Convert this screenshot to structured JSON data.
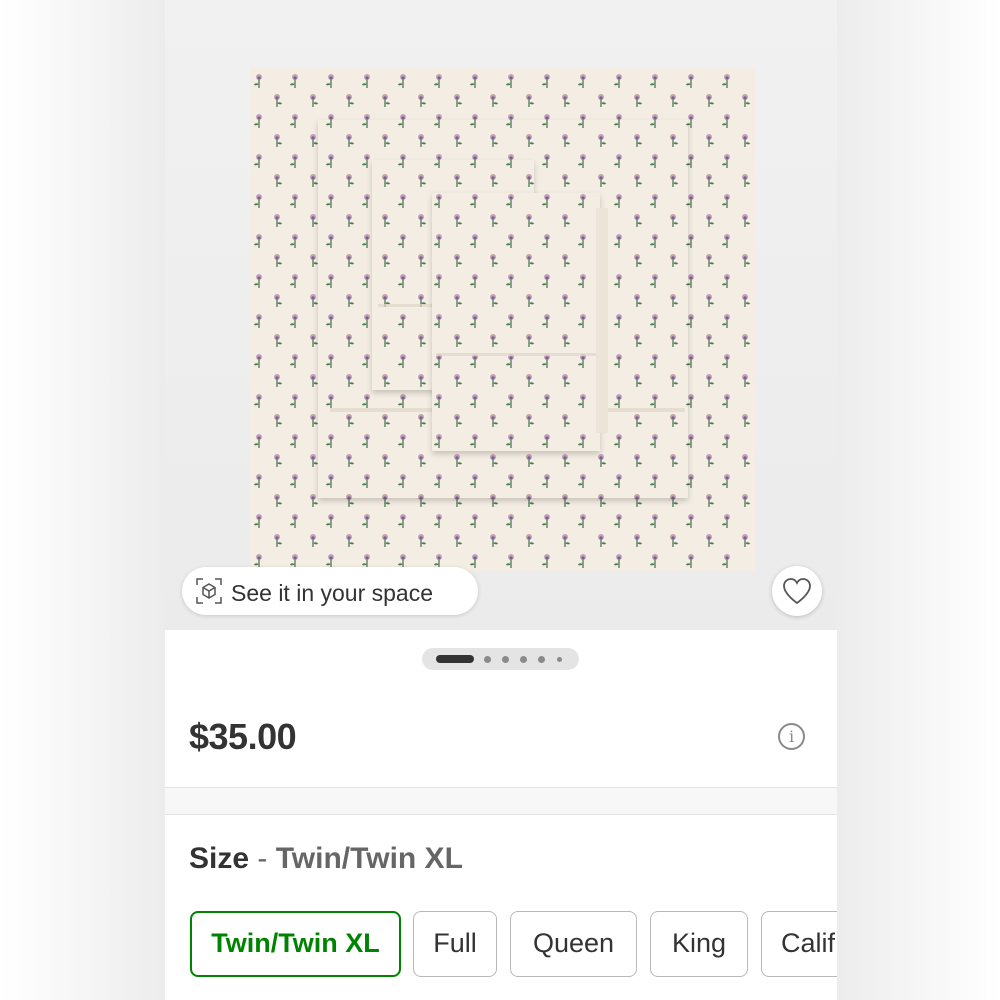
{
  "product": {
    "image_alt": "Floral print sheet set",
    "see_in_space_label": "See it in your space",
    "price": "$35.00",
    "info_glyph": "i"
  },
  "carousel": {
    "total": 6,
    "active": 1
  },
  "size": {
    "label": "Size",
    "separator": " - ",
    "selected": "Twin/Twin XL",
    "options": [
      "Twin/Twin XL",
      "Full",
      "Queen",
      "King",
      "Calif"
    ]
  },
  "colors": {
    "accent_green": "#008300",
    "text_dark": "#333333",
    "text_muted": "#666666",
    "fabric": "#f3ede3",
    "flower_pink": "#c99fb6",
    "flower_purple": "#6e6691",
    "stem_green": "#4f7a56"
  },
  "icons": {
    "ar": "ar-cube-icon",
    "favorite": "heart-outline-icon",
    "info": "info-icon"
  }
}
